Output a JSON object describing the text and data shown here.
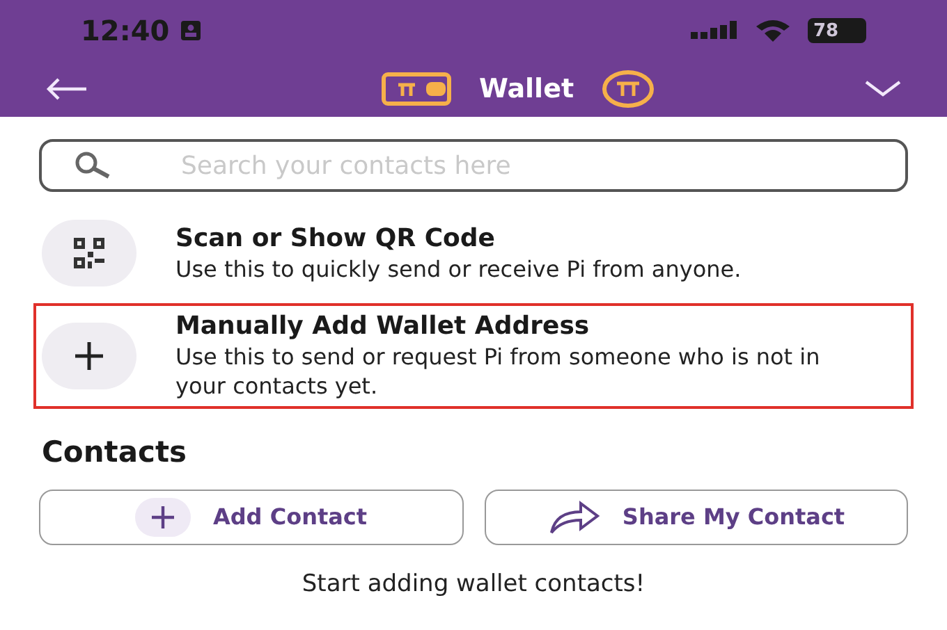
{
  "status_bar": {
    "time": "12:40",
    "battery": "78"
  },
  "header": {
    "title": "Wallet"
  },
  "search": {
    "placeholder": "Search your contacts here"
  },
  "options": [
    {
      "kind": "qr",
      "title": "Scan or Show QR Code",
      "description": "Use this to quickly send or receive Pi from anyone.",
      "highlighted": false
    },
    {
      "kind": "add",
      "title": "Manually Add Wallet Address",
      "description": "Use this to send or request Pi from someone who is not in your contacts yet.",
      "highlighted": true
    }
  ],
  "contacts": {
    "heading": "Contacts",
    "buttons": [
      {
        "kind": "add",
        "label": "Add Contact"
      },
      {
        "kind": "share",
        "label": "Share My Contact"
      }
    ],
    "empty_message": "Start adding wallet contacts!"
  }
}
